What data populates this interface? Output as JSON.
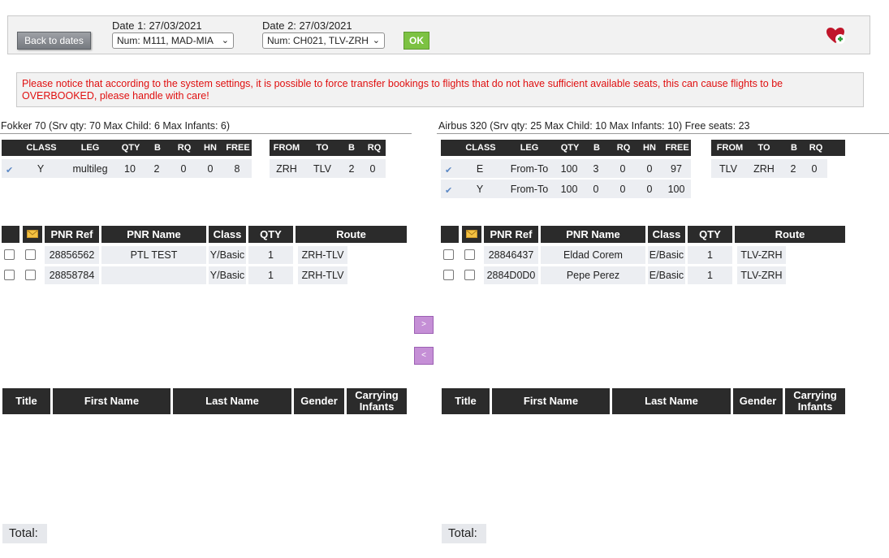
{
  "topbar": {
    "back_label": "Back to dates",
    "date1_key": "Date 1:",
    "date1_value": "27/03/2021",
    "date1_select": "Num: M111, MAD-MIA",
    "date2_key": "Date 2:",
    "date2_value": "27/03/2021",
    "date2_select": "Num: CH021, TLV-ZRH",
    "ok_label": "OK"
  },
  "notice": "Please notice that according to the system settings, it is possible to force transfer bookings to flights that do not have sufficient available seats, this can cause flights to be OVERBOOKED, please handle with care!",
  "left": {
    "title": "Fokker 70 (Srv qty: 70 Max Child: 6 Max Infants: 6)",
    "class_headers": [
      "CLASS",
      "LEG",
      "QTY",
      "B",
      "RQ",
      "HN",
      "FREE"
    ],
    "route_headers": [
      "FROM",
      "TO",
      "B",
      "RQ"
    ],
    "class_rows": [
      {
        "class": "Y",
        "leg": "multileg",
        "qty": "10",
        "b": "2",
        "rq": "0",
        "hn": "0",
        "free": "8"
      }
    ],
    "route_rows": [
      {
        "from": "ZRH",
        "to": "TLV",
        "b": "2",
        "rq": "0"
      }
    ],
    "pnr_headers": [
      "PNR Ref",
      "PNR Name",
      "Class",
      "QTY",
      "Route"
    ],
    "pnr_rows": [
      {
        "ref": "28856562",
        "name": "PTL TEST",
        "class": "Y/Basic",
        "qty": "1",
        "route": "ZRH-TLV"
      },
      {
        "ref": "28858784",
        "name": "",
        "class": "Y/Basic",
        "qty": "1",
        "route": "ZRH-TLV"
      }
    ],
    "pax_headers": [
      "Title",
      "First Name",
      "Last Name",
      "Gender",
      "Carrying Infants"
    ],
    "total_label": "Total:"
  },
  "right": {
    "title": "Airbus 320 (Srv qty: 25 Max Child: 10 Max Infants: 10) Free seats: 23",
    "class_headers": [
      "CLASS",
      "LEG",
      "QTY",
      "B",
      "RQ",
      "HN",
      "FREE"
    ],
    "route_headers": [
      "FROM",
      "TO",
      "B",
      "RQ"
    ],
    "class_rows": [
      {
        "class": "E",
        "leg": "From-To",
        "qty": "100",
        "b": "3",
        "rq": "0",
        "hn": "0",
        "free": "97"
      },
      {
        "class": "Y",
        "leg": "From-To",
        "qty": "100",
        "b": "0",
        "rq": "0",
        "hn": "0",
        "free": "100"
      }
    ],
    "route_rows": [
      {
        "from": "TLV",
        "to": "ZRH",
        "b": "2",
        "rq": "0"
      }
    ],
    "pnr_headers": [
      "PNR Ref",
      "PNR Name",
      "Class",
      "QTY",
      "Route"
    ],
    "pnr_rows": [
      {
        "ref": "28846437",
        "name": "Eldad Corem",
        "class": "E/Basic",
        "qty": "1",
        "route": "TLV-ZRH"
      },
      {
        "ref": "2884D0D0",
        "name": "Pepe Perez",
        "class": "E/Basic",
        "qty": "1",
        "route": "TLV-ZRH"
      }
    ],
    "pax_headers": [
      "Title",
      "First Name",
      "Last Name",
      "Gender",
      "Carrying Infants"
    ],
    "total_label": "Total:"
  },
  "move_right_label": ">",
  "move_left_label": "<",
  "icons": {
    "heart": "heart-plus-icon",
    "mail": "envelope-icon",
    "check": "checkmark-icon"
  },
  "colors": {
    "notice_text": "#e01010",
    "header_bg": "#2b2b2b",
    "ok_green": "#7cc242",
    "arrow_purple": "#c58fd6"
  }
}
